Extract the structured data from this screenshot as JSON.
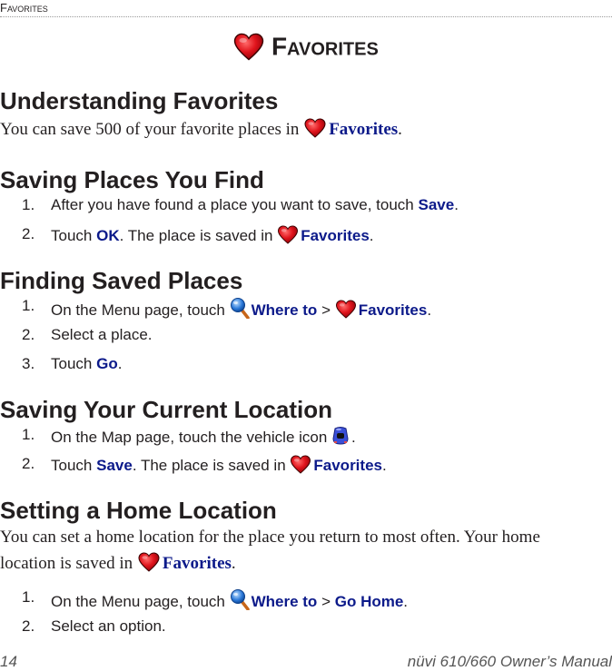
{
  "running_head": "Favorites",
  "chapter_title": "Favorites",
  "sections": [
    {
      "heading": "Understanding Favorites",
      "paragraph": {
        "before": "You can save 500 of your favorite places in",
        "icon": "heart-icon",
        "link": "Favorites",
        "after": "."
      }
    },
    {
      "heading": "Saving Places You Find",
      "steps": [
        {
          "num": "1.",
          "before": "After you have found a place you want to save, touch",
          "link": "Save",
          "after": "."
        },
        {
          "num": "2.",
          "before": "Touch",
          "link": "OK",
          "middle": ". The place is saved in",
          "icon": "heart-icon",
          "link2": "Favorites",
          "after": "."
        }
      ]
    },
    {
      "heading": "Finding Saved Places",
      "steps": [
        {
          "num": "1.",
          "before": "On the Menu page, touch",
          "icon": "magnifier-icon",
          "link": "Where to",
          "sep": ">",
          "icon2": "heart-icon",
          "link2": "Favorites",
          "after": "."
        },
        {
          "num": "2.",
          "text": "Select a place."
        },
        {
          "num": "3.",
          "before": "Touch",
          "link": "Go",
          "after": "."
        }
      ]
    },
    {
      "heading": "Saving Your Current Location",
      "steps": [
        {
          "num": "1.",
          "before": "On the Map page, touch the vehicle icon",
          "icon": "vehicle-icon",
          "after": "."
        },
        {
          "num": "2.",
          "before": "Touch",
          "link": "Save",
          "middle": ". The place is saved in",
          "icon": "heart-icon",
          "link2": "Favorites",
          "after": "."
        }
      ]
    },
    {
      "heading": "Setting a Home Location",
      "paragraph": {
        "line1": "You can set a home location for the place you return to most often. Your home",
        "line2_before": "location is saved in",
        "icon": "heart-icon",
        "link": "Favorites",
        "after": "."
      },
      "steps": [
        {
          "num": "1.",
          "before": "On the Menu page, touch",
          "icon": "magnifier-icon",
          "link": "Where to",
          "sep": ">",
          "link2": "Go Home",
          "after": "."
        },
        {
          "num": "2.",
          "text": "Select an option."
        }
      ]
    }
  ],
  "footer": {
    "page_number": "14",
    "manual_title": "nüvi 610/660 Owner’s Manual"
  },
  "colors": {
    "link": "#0c1a8a",
    "text": "#231f20",
    "heart": "#d4141c"
  }
}
